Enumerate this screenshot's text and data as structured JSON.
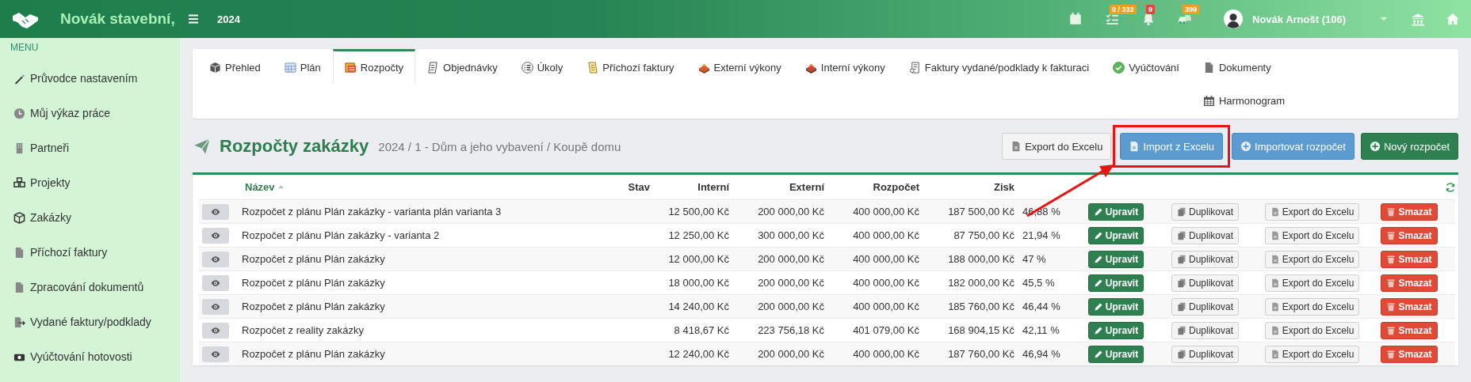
{
  "topbar": {
    "brand": "Novák stavební,",
    "year": "2024",
    "icons": [
      {
        "kind": "calendar"
      },
      {
        "kind": "tasks",
        "badge": "0 / 333",
        "color": "#f0a020"
      },
      {
        "kind": "bell",
        "badge": "9",
        "color": "#e0463a"
      },
      {
        "kind": "cars",
        "badge": "399",
        "color": "#f0a020"
      }
    ],
    "user": "Novák Arnošt (106)"
  },
  "sidebar": {
    "heading": "MENU",
    "items": [
      "Průvodce nastavením",
      "Můj výkaz práce",
      "Partneři",
      "Projekty",
      "Zakázky",
      "Příchozí faktury",
      "Zpracování dokumentů",
      "Vydané faktury/podklady",
      "Vyúčtování hotovosti"
    ]
  },
  "tabs": [
    {
      "label": "Přehled",
      "selected": false
    },
    {
      "label": "Plán",
      "selected": false
    },
    {
      "label": "Rozpočty",
      "selected": true
    },
    {
      "label": "Objednávky",
      "selected": false
    },
    {
      "label": "Úkoly",
      "selected": false
    },
    {
      "label": "Příchozí faktury",
      "selected": false
    },
    {
      "label": "Externí výkony",
      "selected": false
    },
    {
      "label": "Interní výkony",
      "selected": false
    },
    {
      "label": "Faktury vydané/podklady k fakturaci",
      "selected": false
    },
    {
      "label": "Vyúčtování",
      "selected": false
    },
    {
      "label": "Dokumenty",
      "selected": false
    },
    {
      "label": "Harmonogram",
      "selected": false
    }
  ],
  "page_header": {
    "title": "Rozpočty zakázky",
    "subtitle": "2024 / 1 - Dům a jeho vybavení / Koupě domu",
    "buttons": [
      {
        "kind": "export",
        "label": "Export do Excelu",
        "highlighted": false
      },
      {
        "kind": "import",
        "label": "Import z Excelu",
        "highlighted": true
      },
      {
        "kind": "import-budget",
        "label": "Importovat rozpočet",
        "highlighted": false
      },
      {
        "kind": "new",
        "label": "Nový rozpočet",
        "highlighted": false
      }
    ]
  },
  "table": {
    "columns": [
      {
        "label": "Název",
        "sorted": true
      },
      {
        "label": "Stav",
        "sorted": false
      },
      {
        "label": "Interní",
        "sorted": false
      },
      {
        "label": "Externí",
        "sorted": false
      },
      {
        "label": "Rozpočet",
        "sorted": false
      },
      {
        "label": "Zisk",
        "sorted": false
      }
    ],
    "rows": [
      {
        "name": "Rozpočet z plánu Plán zakázky - varianta plán varianta 3",
        "interni": "12 500,00 Kč",
        "externi": "200 000,00 Kč",
        "rozpocet": "400 000,00 Kč",
        "zisk": "187 500,00 Kč",
        "column_8": "46,88 %",
        "actions": [
          {
            "kind": "edit",
            "label": "Upravit"
          },
          {
            "kind": "duplicate",
            "label": "Duplikovat"
          },
          {
            "kind": "export",
            "label": "Export do Excelu"
          },
          {
            "kind": "delete",
            "label": "Smazat"
          }
        ]
      },
      {
        "name": "Rozpočet z plánu Plán zakázky - varianta 2",
        "interni": "12 250,00 Kč",
        "externi": "300 000,00 Kč",
        "rozpocet": "400 000,00 Kč",
        "zisk": "87 750,00 Kč",
        "column_8": "21,94 %",
        "actions": [
          {
            "kind": "edit",
            "label": "Upravit"
          },
          {
            "kind": "duplicate",
            "label": "Duplikovat"
          },
          {
            "kind": "export",
            "label": "Export do Excelu"
          },
          {
            "kind": "delete",
            "label": "Smazat"
          }
        ]
      },
      {
        "name": "Rozpočet z plánu Plán zakázky",
        "interni": "12 000,00 Kč",
        "externi": "200 000,00 Kč",
        "rozpocet": "400 000,00 Kč",
        "zisk": "188 000,00 Kč",
        "column_8": "47 %",
        "actions": [
          {
            "kind": "edit",
            "label": "Upravit"
          },
          {
            "kind": "duplicate",
            "label": "Duplikovat"
          },
          {
            "kind": "export",
            "label": "Export do Excelu"
          },
          {
            "kind": "delete",
            "label": "Smazat"
          }
        ]
      },
      {
        "name": "Rozpočet z plánu Plán zakázky",
        "interni": "18 000,00 Kč",
        "externi": "200 000,00 Kč",
        "rozpocet": "400 000,00 Kč",
        "zisk": "182 000,00 Kč",
        "column_8": "45,5 %",
        "actions": [
          {
            "kind": "edit",
            "label": "Upravit"
          },
          {
            "kind": "duplicate",
            "label": "Duplikovat"
          },
          {
            "kind": "export",
            "label": "Export do Excelu"
          },
          {
            "kind": "delete",
            "label": "Smazat"
          }
        ]
      },
      {
        "name": "Rozpočet z plánu Plán zakázky",
        "interni": "14 240,00 Kč",
        "externi": "200 000,00 Kč",
        "rozpocet": "400 000,00 Kč",
        "zisk": "185 760,00 Kč",
        "column_8": "46,44 %",
        "actions": [
          {
            "kind": "edit",
            "label": "Upravit"
          },
          {
            "kind": "duplicate",
            "label": "Duplikovat"
          },
          {
            "kind": "export",
            "label": "Export do Excelu"
          },
          {
            "kind": "delete",
            "label": "Smazat"
          }
        ]
      },
      {
        "name": "Rozpočet z reality zakázky",
        "interni": "8 418,67 Kč",
        "externi": "223 756,18 Kč",
        "rozpocet": "401 079,00 Kč",
        "zisk": "168 904,15 Kč",
        "column_8": "42,11 %",
        "actions": [
          {
            "kind": "edit",
            "label": "Upravit"
          },
          {
            "kind": "duplicate",
            "label": "Duplikovat"
          },
          {
            "kind": "export",
            "label": "Export do Excelu"
          },
          {
            "kind": "delete",
            "label": "Smazat"
          }
        ]
      },
      {
        "name": "Rozpočet z plánu Plán zakázky",
        "interni": "12 240,00 Kč",
        "externi": "200 000,00 Kč",
        "rozpocet": "400 000,00 Kč",
        "zisk": "187 760,00 Kč",
        "column_8": "46,94 %",
        "actions": [
          {
            "kind": "edit",
            "label": "Upravit"
          },
          {
            "kind": "duplicate",
            "label": "Duplikovat"
          },
          {
            "kind": "export",
            "label": "Export do Excelu"
          },
          {
            "kind": "delete",
            "label": "Smazat"
          }
        ]
      }
    ]
  }
}
